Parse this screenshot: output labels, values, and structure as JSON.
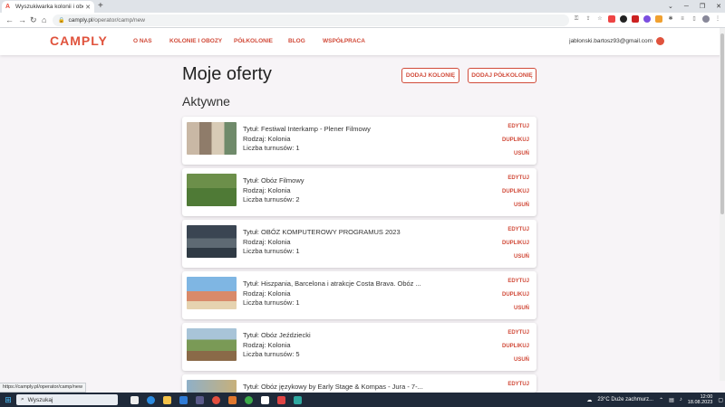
{
  "browser": {
    "tab_title": "Wyszukiwarka kolonii i obozów",
    "url_domain": "camply.pl",
    "url_path": "/operator/camp/new",
    "status_url": "https://camply.pl/operator/camp/new"
  },
  "header": {
    "logo": "CAMPLY",
    "nav": [
      "O NAS",
      "KOLONIE I OBOZY",
      "PÓŁKOLONIE",
      "BLOG",
      "WSPÓŁPRACA"
    ],
    "user_email": "jablonski.bartosz93@gmail.com"
  },
  "main": {
    "title": "Moje oferty",
    "btn_add_colony": "DODAJ KOLONIĘ",
    "btn_add_halfcolony": "DODAJ PÓŁKOLONIĘ",
    "section_title": "Aktywne",
    "actions": {
      "edit": "EDYTUJ",
      "duplicate": "DUPLIKUJ",
      "delete": "USUŃ"
    },
    "offers": [
      {
        "title": "Tytuł: Festiwal Interkamp - Plener Filmowy",
        "type": "Rodzaj: Kolonia",
        "turns": "Liczba turnusów: 1"
      },
      {
        "title": "Tytuł: Obóz Filmowy",
        "type": "Rodzaj: Kolonia",
        "turns": "Liczba turnusów: 2"
      },
      {
        "title": "Tytuł: OBÓZ KOMPUTEROWY PROGRAMUS 2023",
        "type": "Rodzaj: Kolonia",
        "turns": "Liczba turnusów: 1"
      },
      {
        "title": "Tytuł: Hiszpania, Barcelona i atrakcje Costa Brava. Obóz ...",
        "type": "Rodzaj: Kolonia",
        "turns": "Liczba turnusów: 1"
      },
      {
        "title": "Tytuł: Obóz Jeździecki",
        "type": "Rodzaj: Kolonia",
        "turns": "Liczba turnusów: 5"
      },
      {
        "title": "Tytuł: Obóz językowy by Early Stage & Kompas - Jura - 7-...",
        "type": "",
        "turns": ""
      }
    ]
  },
  "taskbar": {
    "search": "Wyszukaj",
    "weather": "23°C  Duże zachmurz...",
    "time": "12:00",
    "date": "18.08.2023"
  },
  "colors": {
    "brand": "#d14b3a",
    "logo": "#e0533d"
  }
}
